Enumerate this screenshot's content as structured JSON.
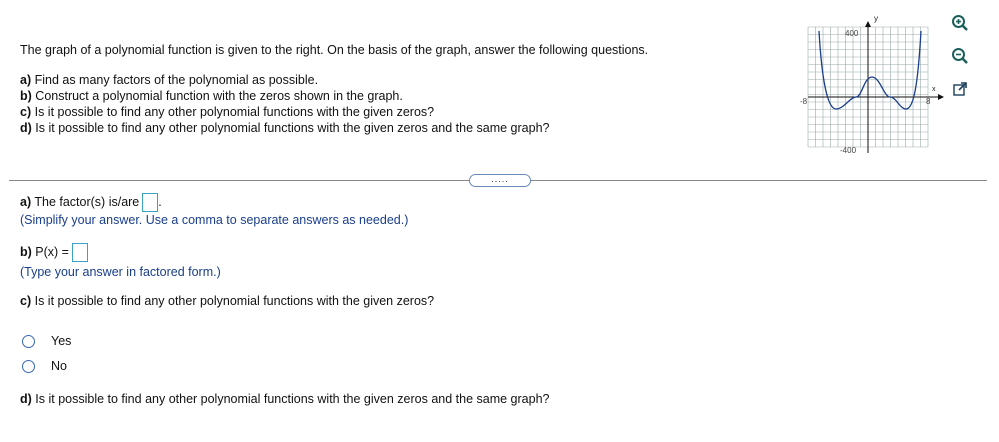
{
  "question": {
    "intro": "The graph of a polynomial function is given to the right. On the basis of the graph, answer the following questions.",
    "items": [
      {
        "prefix": "a)",
        "text": " Find as many factors of the polynomial as possible."
      },
      {
        "prefix": "b)",
        "text": " Construct a polynomial function with the zeros shown in the graph."
      },
      {
        "prefix": "c)",
        "text": " Is it possible to find any other polynomial functions with the given zeros?"
      },
      {
        "prefix": "d)",
        "text": " Is it possible to find any other polynomial functions with the given zeros and the same graph?"
      }
    ]
  },
  "graph": {
    "y_label": "y",
    "x_label": "x",
    "y_max_label": "400",
    "y_min_label": "-400",
    "x_min_label": "-8",
    "x_max_label": "8"
  },
  "tools": [
    "zoom-in-icon",
    "zoom-out-icon",
    "pop-out-icon"
  ],
  "expander_label": ".....",
  "part_a": {
    "label_bold": "a)",
    "label": " The factor(s) is/are",
    "suffix": ".",
    "hint": "(Simplify your answer. Use a comma to separate answers as needed.)"
  },
  "part_b": {
    "label_bold": "b)",
    "label": " P(x) =",
    "hint": "(Type your answer in factored form.)"
  },
  "part_c": {
    "label_bold": "c)",
    "label": " Is it possible to find any other polynomial functions with the given zeros?",
    "options": [
      "Yes",
      "No"
    ]
  },
  "part_d": {
    "label_bold": "d)",
    "label": " Is it possible to find any other polynomial functions with the given zeros and the same graph?"
  }
}
